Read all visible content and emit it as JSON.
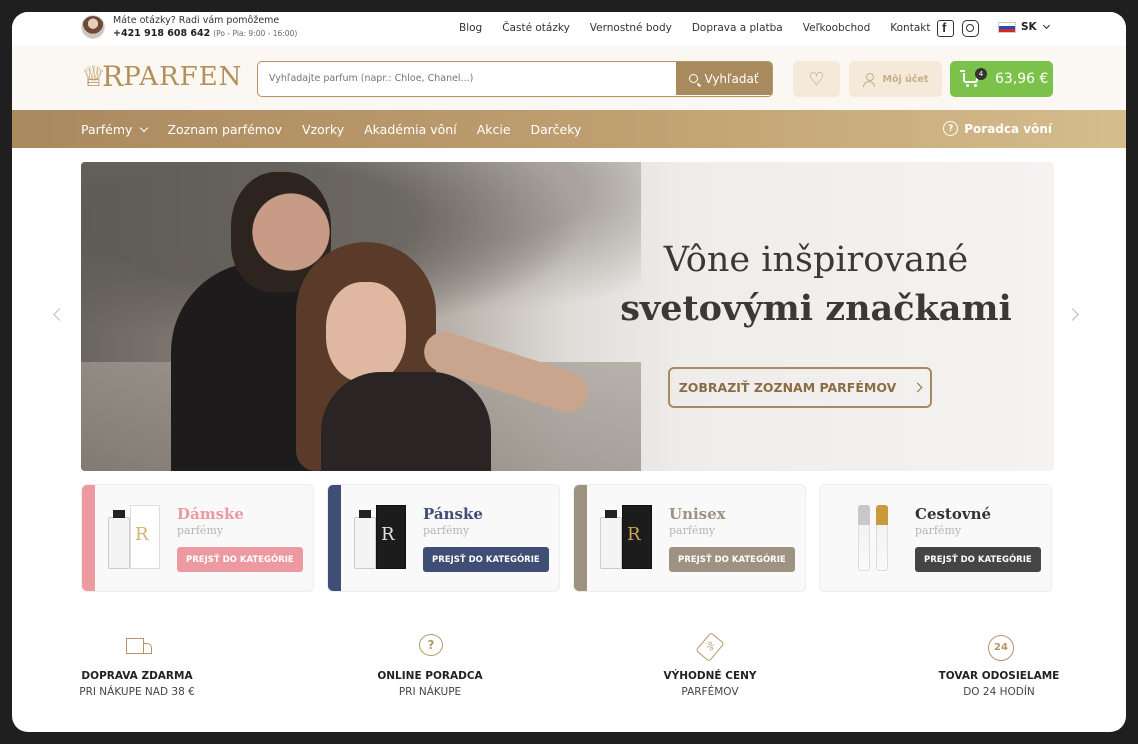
{
  "topbar": {
    "help_line1": "Máte otázky? Radi vám pomôžeme",
    "help_phone": "+421 918 608 642",
    "help_hours": "(Po - Pia: 9:00 - 16:00)",
    "links": [
      "Blog",
      "Časté otázky",
      "Vernostné body",
      "Doprava a platba",
      "Veľkoobchod",
      "Kontakt"
    ],
    "language": "SK"
  },
  "header": {
    "logo_text": "PARFEN",
    "search_placeholder": "Vyhľadajte parfum (napr.: Chloe, Chanel...)",
    "search_button": "Vyhľadať",
    "account_label": "Môj účet",
    "cart_count": "4",
    "cart_total": "63,96 €"
  },
  "nav": {
    "items": [
      "Parfémy",
      "Zoznam parfémov",
      "Vzorky",
      "Akadémia vôní",
      "Akcie",
      "Darčeky"
    ],
    "advisor": "Poradca vôní"
  },
  "hero": {
    "title_line1": "Vône inšpirované",
    "title_line2": "svetovými značkami",
    "cta": "ZOBRAZIŤ ZOZNAM PARFÉMOV"
  },
  "categories": [
    {
      "name": "Dámske",
      "sub": "parfémy",
      "button": "PREJSŤ DO KATEGÓRIE",
      "color": "#ec9aa0"
    },
    {
      "name": "Pánske",
      "sub": "parfémy",
      "button": "PREJSŤ DO KATEGÓRIE",
      "color": "#3f4e75"
    },
    {
      "name": "Unisex",
      "sub": "parfémy",
      "button": "PREJSŤ DO KATEGÓRIE",
      "color": "#9e9380"
    },
    {
      "name": "Cestovné",
      "sub": "parfémy",
      "button": "PREJSŤ DO KATEGÓRIE",
      "color": "#454545"
    }
  ],
  "benefits": [
    {
      "icon": "truck-icon",
      "title": "DOPRAVA ZDARMA",
      "sub": "PRI NÁKUPE NAD 38 €"
    },
    {
      "icon": "chat-question-icon",
      "title": "ONLINE PORADCA",
      "sub": "PRI NÁKUPE"
    },
    {
      "icon": "price-tag-icon",
      "title": "VÝHODNÉ CENY",
      "sub": "PARFÉMOV"
    },
    {
      "icon": "24h-delivery-icon",
      "title": "TOVAR ODOSIELAME",
      "sub": "DO 24 HODÍN"
    }
  ],
  "colors": {
    "gold": "#a9895e",
    "green": "#7cc24a"
  }
}
